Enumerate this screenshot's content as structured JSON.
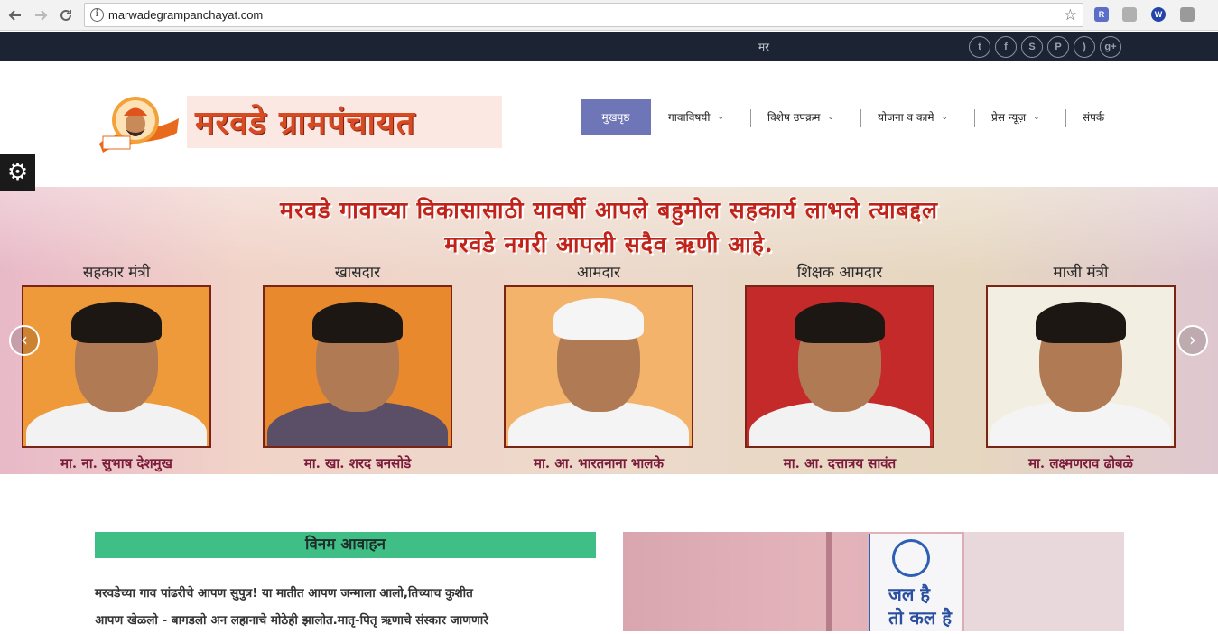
{
  "browser": {
    "url": "marwadegrampanchayat.com",
    "extensions": [
      {
        "name": "r-extension-icon",
        "label": "R",
        "color": "#5b6fc8"
      },
      {
        "name": "pdf-extension-icon",
        "label": "",
        "color": "#b0b0b0"
      },
      {
        "name": "w-extension-icon",
        "label": "W",
        "color": "#2444a8"
      },
      {
        "name": "cube-extension-icon",
        "label": "",
        "color": "#9a9a9a"
      }
    ]
  },
  "topbar": {
    "lang": "मर",
    "social": [
      {
        "name": "twitter-icon",
        "glyph": "t"
      },
      {
        "name": "facebook-icon",
        "glyph": "f"
      },
      {
        "name": "skype-icon",
        "glyph": "S"
      },
      {
        "name": "pinterest-icon",
        "glyph": "P"
      },
      {
        "name": "rss-icon",
        "glyph": ")"
      },
      {
        "name": "google-plus-icon",
        "glyph": "g+"
      }
    ]
  },
  "header": {
    "site_title": "मरवडे ग्रामपंचायत",
    "menu": [
      {
        "label": "मुखपृष्ठ",
        "active": true,
        "dropdown": false
      },
      {
        "label": "गावाविषयी",
        "active": false,
        "dropdown": true
      },
      {
        "label": "विशेष उपक्रम",
        "active": false,
        "dropdown": true
      },
      {
        "label": "योजना व कामे",
        "active": false,
        "dropdown": true
      },
      {
        "label": "प्रेस न्यूज़",
        "active": false,
        "dropdown": true
      },
      {
        "label": "संपर्क",
        "active": false,
        "dropdown": false
      }
    ],
    "accent_color": "#6f76b8"
  },
  "slider": {
    "line1": "मरवडे गावाच्या विकासासाठी यावर्षी आपले बहुमोल सहकार्य लाभले त्याबद्दल",
    "line2": "मरवडे नगरी आपली सदैव ऋणी आहे.",
    "people": [
      {
        "role": "सहकार मंत्री",
        "name": "मा. ना. सुभाष देशमुख",
        "bg": "#ef9a3a",
        "shirt": "#f2f2f2"
      },
      {
        "role": "खासदार",
        "name": "मा. खा. शरद बनसोडे",
        "bg": "#e8892e",
        "shirt": "#5a4f66"
      },
      {
        "role": "आमदार",
        "name": "मा. आ. भारतनाना भालके",
        "bg": "#f4b36a",
        "shirt": "#f4f4f4"
      },
      {
        "role": "शिक्षक आमदार",
        "name": "मा. आ. दत्तात्रय सावंत",
        "bg": "#c42a2a",
        "shirt": "#f2f2f2"
      },
      {
        "role": "माजी मंत्री",
        "name": "मा. लक्ष्मणराव ढोबळे",
        "bg": "#f3eee2",
        "shirt": "#f4f4f4"
      }
    ]
  },
  "content": {
    "heading": "विनम आवाहन",
    "paragraph_line1": "मरवडेच्या गाव पांढरीचे आपण सुपुत्र! या मातीत आपण जन्माला आलो,तिच्याच कुशीत",
    "paragraph_line2": "आपण खेळलो - बागडलो अन लहानाचे मोठेही झालोत.मातृ-पितृ ऋणाचे संस्कार जाणणारे",
    "sign_text": "जल है\nतो कल है",
    "heading_color": "#3fbf86"
  }
}
